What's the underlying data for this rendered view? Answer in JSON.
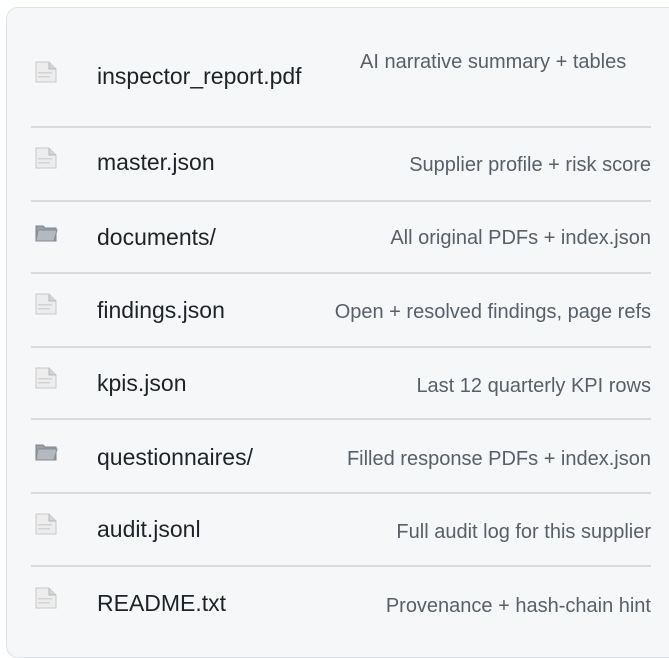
{
  "files": [
    {
      "name": "inspector_report.pdf",
      "type": "file",
      "icon": "file-icon",
      "description": "AI narrative summary + tables"
    },
    {
      "name": "master.json",
      "type": "file",
      "icon": "file-icon",
      "description": "Supplier profile + risk score"
    },
    {
      "name": "documents/",
      "type": "folder",
      "icon": "folder-icon",
      "description": "All original PDFs + index.json"
    },
    {
      "name": "findings.json",
      "type": "file",
      "icon": "file-icon",
      "description": "Open + resolved findings, page refs"
    },
    {
      "name": "kpis.json",
      "type": "file",
      "icon": "file-icon",
      "description": "Last 12 quarterly KPI rows"
    },
    {
      "name": "questionnaires/",
      "type": "folder",
      "icon": "folder-icon",
      "description": "Filled response PDFs + index.json"
    },
    {
      "name": "audit.jsonl",
      "type": "file",
      "icon": "file-icon",
      "description": "Full audit log for this supplier"
    },
    {
      "name": "README.txt",
      "type": "file",
      "icon": "file-icon",
      "description": "Provenance + hash-chain hint"
    }
  ]
}
